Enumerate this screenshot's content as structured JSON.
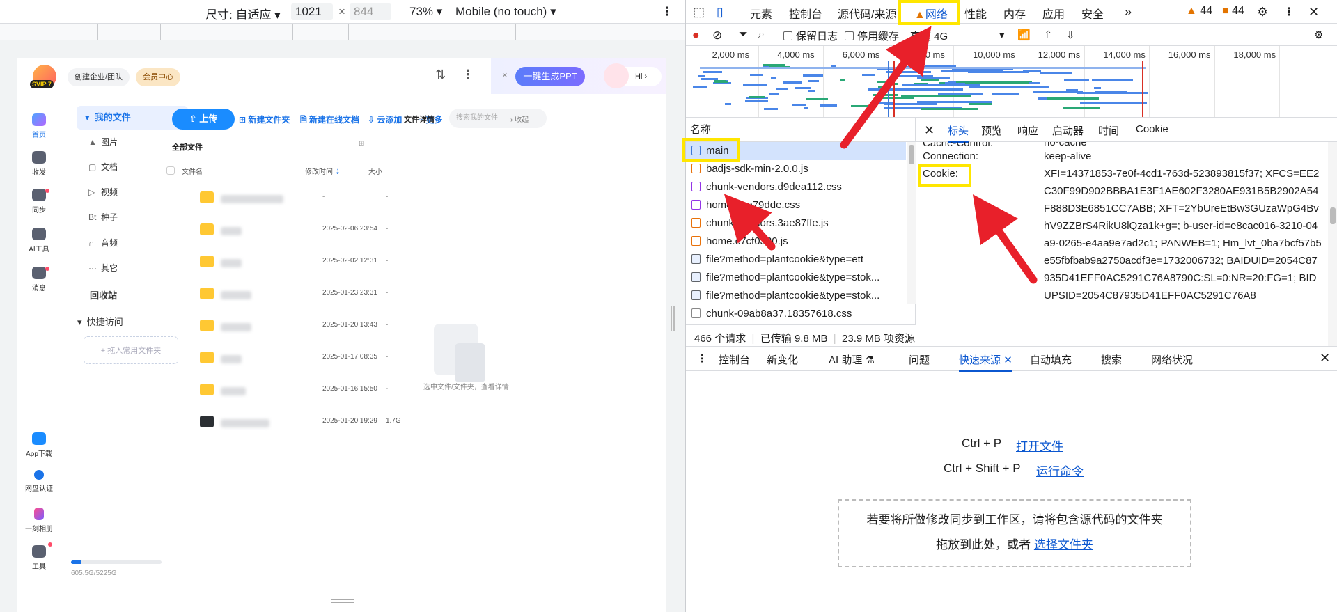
{
  "device_toolbar": {
    "size_label": "尺寸: 自适应",
    "width": "1021",
    "times": "×",
    "height": "844",
    "zoom": "73%",
    "throttle": "Mobile (no touch)"
  },
  "page": {
    "header": {
      "badge_text": "SVIP 7",
      "create_team": "创建企业/团队",
      "vip_center": "会员中心",
      "ppt_button": "一键生成PPT",
      "hi": "Hi"
    },
    "left_nav": [
      {
        "label": "首页"
      },
      {
        "label": "收发"
      },
      {
        "label": "同步"
      },
      {
        "label": "AI工具"
      },
      {
        "label": "消息"
      },
      {
        "label": "App下载"
      },
      {
        "label": "网盘认证"
      },
      {
        "label": "一刻相册"
      },
      {
        "label": "工具"
      }
    ],
    "tree": {
      "my_files": "我的文件",
      "items": [
        "图片",
        "文档",
        "视频",
        "种子",
        "音频",
        "其它"
      ],
      "item_glyphs": [
        "▲",
        "▢",
        "▷",
        "Bt",
        "∩",
        "···"
      ],
      "recycle": "回收站",
      "quick_access": "快捷访问",
      "add_fav": "+ 拖入常用文件夹"
    },
    "quota": {
      "text": "605.5G/5225G",
      "used_fraction": 0.116
    },
    "toolbar": {
      "upload": "上传",
      "new_folder": "新建文件夹",
      "new_doc": "新建在线文档",
      "cloud_add": "云添加",
      "more": "更多",
      "search_placeholder": "搜索我的文件"
    },
    "list": {
      "title": "全部文件",
      "col_name": "文件名",
      "col_modified": "修改时间",
      "col_size": "大小",
      "rows": [
        {
          "date": "-",
          "size": "-"
        },
        {
          "date": "2025-02-06 23:54",
          "size": "-"
        },
        {
          "date": "2025-02-02 12:31",
          "size": "-"
        },
        {
          "date": "2025-01-23 23:31",
          "size": "-"
        },
        {
          "date": "2025-01-20 13:43",
          "size": "-"
        },
        {
          "date": "2025-01-17 08:35",
          "size": "-"
        },
        {
          "date": "2025-01-16 15:50",
          "size": "-"
        },
        {
          "date": "2025-01-20 19:29",
          "size": "1.7G"
        }
      ]
    },
    "detail": {
      "title": "文件详情",
      "collapse": "收起",
      "empty_text": "选中文件/文件夹，查看详情"
    }
  },
  "devtools": {
    "tabs": [
      "元素",
      "控制台",
      "源代码/来源",
      "网络",
      "性能",
      "内存",
      "应用",
      "安全"
    ],
    "more_tabs": "»",
    "warnings": "44",
    "errors": "44",
    "net_toolbar": {
      "preserve_log": "保留日志",
      "disable_cache": "停用缓存",
      "throttle": "高速 4G"
    },
    "overview_ticks": [
      "2,000 ms",
      "4,000 ms",
      "6,000 ms",
      "8,000 ms",
      "10,000 ms",
      "12,000 ms",
      "14,000 ms",
      "16,000 ms",
      "18,000 ms"
    ],
    "request_list": {
      "header": "名称",
      "items": [
        {
          "name": "main",
          "type": "doc"
        },
        {
          "name": "badjs-sdk-min-2.0.0.js",
          "type": "js"
        },
        {
          "name": "chunk-vendors.d9dea112.css",
          "type": "css"
        },
        {
          "name": "home.2be79dde.css",
          "type": "css"
        },
        {
          "name": "chunk-vendors.3ae87ffe.js",
          "type": "js"
        },
        {
          "name": "home.c7cf0330.js",
          "type": "js"
        },
        {
          "name": "file?method=plantcookie&type=ett",
          "type": "file"
        },
        {
          "name": "file?method=plantcookie&type=stok...",
          "type": "file"
        },
        {
          "name": "file?method=plantcookie&type=stok...",
          "type": "file"
        },
        {
          "name": "chunk-09ab8a37.18357618.css",
          "type": "blank"
        }
      ],
      "footer": {
        "requests": "466 个请求",
        "transferred": "已传输 9.8 MB",
        "resources": "23.9 MB 项资源"
      }
    },
    "headers_panel": {
      "tabs": [
        "标头",
        "预览",
        "响应",
        "启动器",
        "时间",
        "Cookie"
      ],
      "rows": [
        {
          "key": "Cache-Control:",
          "value": "no-cache"
        },
        {
          "key": "Connection:",
          "value": "keep-alive"
        },
        {
          "key": "Cookie:",
          "value": "XFI=14371853-7e0f-4cd1-763d-523893815f37; XFCS=EE2C30F99D902BBBA1E3F1AE602F3280AE931B5B2902A54F888D3E6851CC7ABB; XFT=2YbUreEtBw3GUzaWpG4BvhV9ZZBrS4RikU8lQza1k+g=; b-user-id=e8cac016-3210-04a9-0265-e4aa9e7ad2c1; PANWEB=1; Hm_lvt_0ba7bcf57b5e55fbfbab9a2750acdf3e=1732006732; BAIDUID=2054C87935D41EFF0AC5291C76A8790C:SL=0:NR=20:FG=1; BIDUPSID=2054C87935D41EFF0AC5291C76A8"
        }
      ]
    },
    "drawer_tabs": [
      "控制台",
      "新变化",
      "AI 助理",
      "问题",
      "快速来源",
      "自动填充",
      "搜索",
      "网络状况"
    ],
    "sources_empty": {
      "shortcut1": "Ctrl + P",
      "action1": "打开文件",
      "shortcut2": "Ctrl + Shift + P",
      "action2": "运行命令",
      "drop_line1": "若要将所做修改同步到工作区，请将包含源代码的文件夹",
      "drop_line2": "拖放到此处，或者",
      "drop_link": "选择文件夹"
    }
  },
  "colors": {
    "highlight": "#ffe600",
    "arrow": "#e8202a",
    "accent": "#0b57d0",
    "pan_blue": "#1a8cff"
  }
}
